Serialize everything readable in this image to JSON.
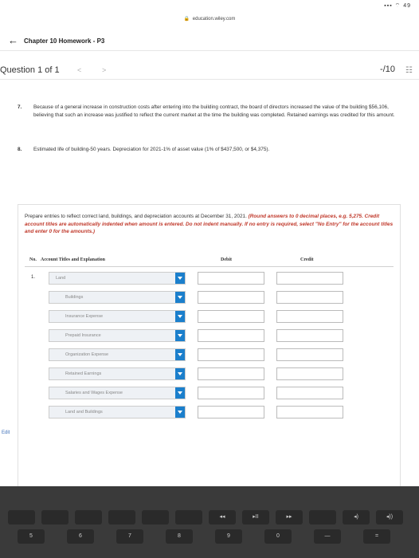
{
  "status": {
    "signal": "▪▪▪ ⌔ 49"
  },
  "browser": {
    "url": "education.wiley.com"
  },
  "nav": {
    "chapter_title": "Chapter 10 Homework - P3"
  },
  "question": {
    "label": "Question 1 of 1",
    "score": "-/10"
  },
  "items": [
    {
      "num": "7.",
      "text": "Because of a general increase in construction costs after entering into the building contract, the board of directors increased the value of the building $56,106, believing that such an increase was justified to reflect the current market at the time the building was completed. Retained earnings was credited for this amount."
    },
    {
      "num": "8.",
      "text": "Estimated life of building-50 years. Depreciation for 2021-1% of asset value (1% of $437,500, or $4,375)."
    }
  ],
  "instructions": {
    "main": "Prepare entries to reflect correct land, buildings, and depreciation accounts at December 31, 2021.",
    "note": "(Round answers to 0 decimal places, e.g. 5,275. Credit account titles are automatically indented when amount is entered. Do not indent manually. If no entry is required, select \"No Entry\" for the account titles and enter 0 for the amounts.)"
  },
  "table": {
    "headers": {
      "no": "No.",
      "account": "Account Titles and Explanation",
      "debit": "Debit",
      "credit": "Credit"
    },
    "rows": [
      {
        "no": "1.",
        "account": "Land"
      },
      {
        "no": "",
        "account": "Buildings"
      },
      {
        "no": "",
        "account": "Insurance Expense"
      },
      {
        "no": "",
        "account": "Prepaid Insurance"
      },
      {
        "no": "",
        "account": "Organization Expense"
      },
      {
        "no": "",
        "account": "Retained Earnings"
      },
      {
        "no": "",
        "account": "Salaries and Wages Expense"
      },
      {
        "no": "",
        "account": "Land and Buildings"
      }
    ]
  },
  "edge_label": "Edit",
  "keyboard": {
    "fkeys": [
      "",
      "",
      "",
      "",
      "",
      "",
      "◂◂",
      "▸II",
      "▸▸",
      "",
      "◂)",
      "◂))"
    ],
    "numkeys": [
      "5",
      "6",
      "7",
      "8",
      "9",
      "0",
      "—",
      "="
    ]
  }
}
